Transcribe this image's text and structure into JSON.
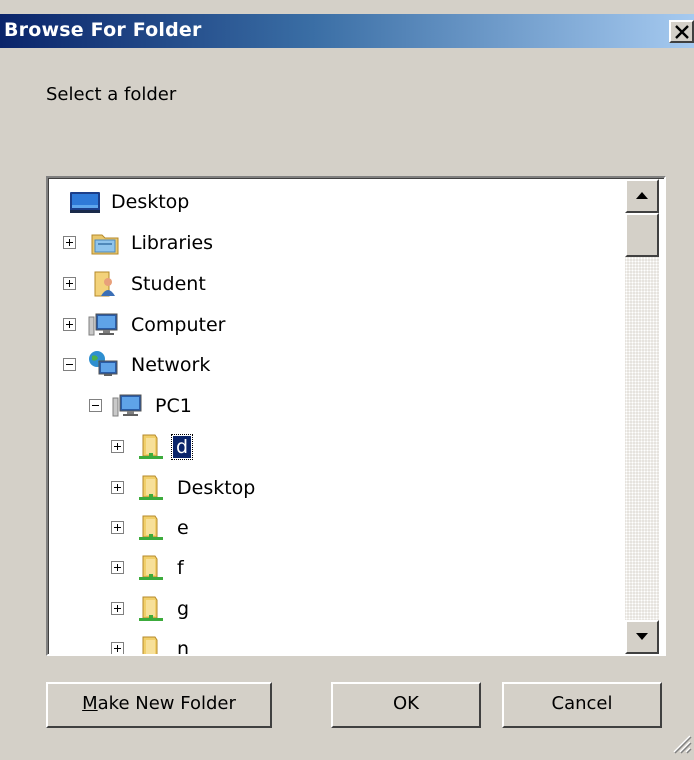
{
  "window": {
    "title": "Browse For Folder",
    "close_label": "×"
  },
  "prompt": "Select a folder",
  "tree": {
    "items": [
      {
        "label": "Desktop",
        "icon": "desktop-icon",
        "expander": "none",
        "level": 0
      },
      {
        "label": "Libraries",
        "icon": "libraries-icon",
        "expander": "plus",
        "level": 0
      },
      {
        "label": "Student",
        "icon": "user-folder-icon",
        "expander": "plus",
        "level": 0
      },
      {
        "label": "Computer",
        "icon": "computer-icon",
        "expander": "plus",
        "level": 0
      },
      {
        "label": "Network",
        "icon": "network-icon",
        "expander": "minus",
        "level": 0
      },
      {
        "label": "PC1",
        "icon": "computer-icon",
        "expander": "minus",
        "level": 1
      },
      {
        "label": "d",
        "icon": "shared-folder-icon",
        "expander": "plus",
        "level": 2,
        "selected": true
      },
      {
        "label": "Desktop",
        "icon": "shared-folder-icon",
        "expander": "plus",
        "level": 2
      },
      {
        "label": "e",
        "icon": "shared-folder-icon",
        "expander": "plus",
        "level": 2
      },
      {
        "label": "f",
        "icon": "shared-folder-icon",
        "expander": "plus",
        "level": 2
      },
      {
        "label": "g",
        "icon": "shared-folder-icon",
        "expander": "plus",
        "level": 2
      },
      {
        "label": "n",
        "icon": "shared-folder-icon",
        "expander": "plus",
        "level": 2
      }
    ]
  },
  "buttons": {
    "new_folder_mnemonic": "M",
    "new_folder_rest": "ake New Folder",
    "ok": "OK",
    "cancel": "Cancel"
  },
  "colors": {
    "titlebar_start": "#0a246a",
    "titlebar_end": "#a6caf0",
    "dialog_face": "#d4d0c8",
    "selection": "#0a246a"
  }
}
